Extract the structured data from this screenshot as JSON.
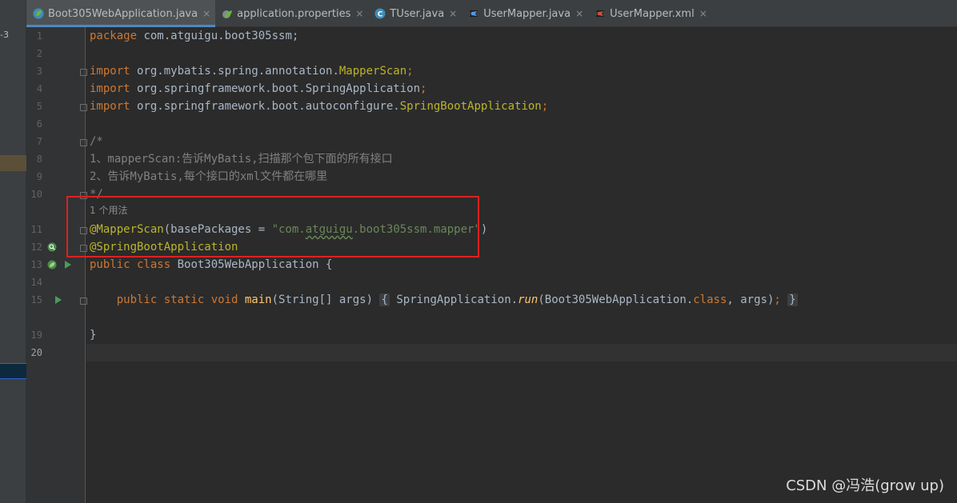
{
  "left_strip": {
    "text": "-3"
  },
  "tabs": [
    {
      "label": "Boot305WebApplication.java",
      "icon": "spring-class-icon",
      "active": true
    },
    {
      "label": "application.properties",
      "icon": "spring-properties-icon",
      "active": false
    },
    {
      "label": "TUser.java",
      "icon": "class-icon",
      "active": false
    },
    {
      "label": "UserMapper.java",
      "icon": "mybatis-mapper-icon",
      "active": false
    },
    {
      "label": "UserMapper.xml",
      "icon": "mybatis-xml-icon",
      "active": false
    }
  ],
  "tab_close_glyph": "×",
  "line_numbers": [
    "1",
    "2",
    "3",
    "4",
    "5",
    "6",
    "7",
    "8",
    "9",
    "10",
    "11",
    "12",
    "13",
    "14",
    "15",
    "19",
    "20"
  ],
  "code": {
    "l1": {
      "kw": "package",
      "rest": " com.atguigu.boot305ssm;"
    },
    "l3": {
      "kw": "import",
      "pkg": " org.mybatis.spring.annotation.",
      "cls": "MapperScan",
      "semi": ";"
    },
    "l4": {
      "kw": "import",
      "pkg": " org.springframework.boot.SpringApplication",
      "semi": ";"
    },
    "l5": {
      "kw": "import",
      "pkg": " org.springframework.boot.autoconfigure.",
      "cls": "SpringBootApplication",
      "semi": ";"
    },
    "l7": "/*",
    "l8": "1、mapperScan:告诉MyBatis,扫描那个包下面的所有接口",
    "l9": "2、告诉MyBatis,每个接口的xml文件都在哪里",
    "l10": "*/",
    "usage_hint": "1 个用法",
    "l11": {
      "anno": "@MapperScan",
      "open": "(basePackages = ",
      "q1": "\"com.",
      "squig": "atguigu",
      "q2": ".boot305ssm.mapper\"",
      "close": ")"
    },
    "l12": {
      "anno": "@SpringBootApplication"
    },
    "l13": {
      "kw": "public class",
      "rest": " Boot305WebApplication {"
    },
    "l15": {
      "kw": "public static void",
      "fn": " main",
      "params": "(String[] args)",
      "brace_open": "{",
      "call1": " SpringApplication.",
      "run": "run",
      "call2": "(Boot305WebApplication.",
      "cls_kw": "class",
      "call3": ", args)",
      "semi": ";",
      "brace_close": "}"
    },
    "l19": "}"
  },
  "watermark": "CSDN @冯浩(grow up)",
  "colors": {
    "keyword": "#cc7832",
    "annotation": "#bbb529",
    "string": "#6a8759",
    "comment": "#808080",
    "method": "#ffc66d",
    "text": "#a9b7c6",
    "highlight_box": "#e02020"
  }
}
